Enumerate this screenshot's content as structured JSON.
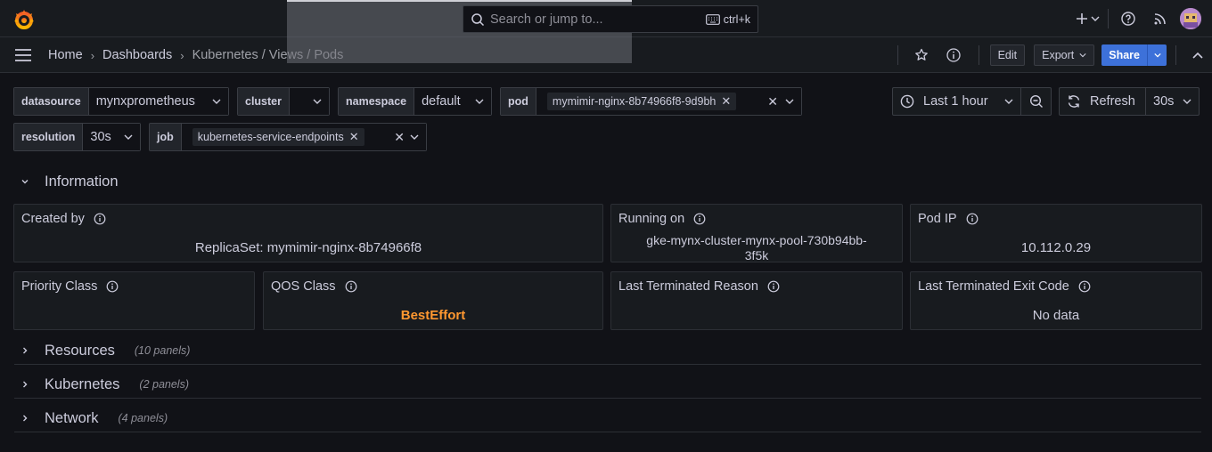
{
  "topbar": {
    "search_placeholder": "Search or jump to...",
    "shortcut": "ctrl+k"
  },
  "breadcrumb": {
    "items": [
      "Home",
      "Dashboards",
      "Kubernetes / Views / Pods"
    ]
  },
  "actions": {
    "edit": "Edit",
    "export": "Export",
    "share": "Share"
  },
  "variables": {
    "datasource": {
      "label": "datasource",
      "value": "mynxprometheus"
    },
    "cluster": {
      "label": "cluster",
      "value": ""
    },
    "namespace": {
      "label": "namespace",
      "value": "default"
    },
    "pod": {
      "label": "pod",
      "value": "mymimir-nginx-8b74966f8-9d9bh"
    },
    "resolution": {
      "label": "resolution",
      "value": "30s"
    },
    "job": {
      "label": "job",
      "value": "kubernetes-service-endpoints"
    }
  },
  "time": {
    "range": "Last 1 hour",
    "refresh_label": "Refresh",
    "refresh_interval": "30s"
  },
  "rows": {
    "information": {
      "title": "Information"
    },
    "resources": {
      "title": "Resources",
      "count": "(10 panels)"
    },
    "kubernetes": {
      "title": "Kubernetes",
      "count": "(2 panels)"
    },
    "network": {
      "title": "Network",
      "count": "(4 panels)"
    }
  },
  "panels": {
    "created_by": {
      "title": "Created by",
      "value": "ReplicaSet: mymimir-nginx-8b74966f8"
    },
    "running_on": {
      "title": "Running on",
      "value_line1": "gke-mynx-cluster-mynx-pool-730b94bb-",
      "value_line2": "3f5k"
    },
    "pod_ip": {
      "title": "Pod IP",
      "value": "10.112.0.29"
    },
    "priority_class": {
      "title": "Priority Class",
      "value": ""
    },
    "qos_class": {
      "title": "QOS Class",
      "value": "BestEffort"
    },
    "last_terminated_reason": {
      "title": "Last Terminated Reason",
      "value": ""
    },
    "last_terminated_exit_code": {
      "title": "Last Terminated Exit Code",
      "value": "No data"
    }
  },
  "colors": {
    "background": "#111217",
    "panel": "#181b1f",
    "accent_blue": "#3d71d9",
    "warning_orange": "#ff9830",
    "logo_orange": "#f46800"
  }
}
